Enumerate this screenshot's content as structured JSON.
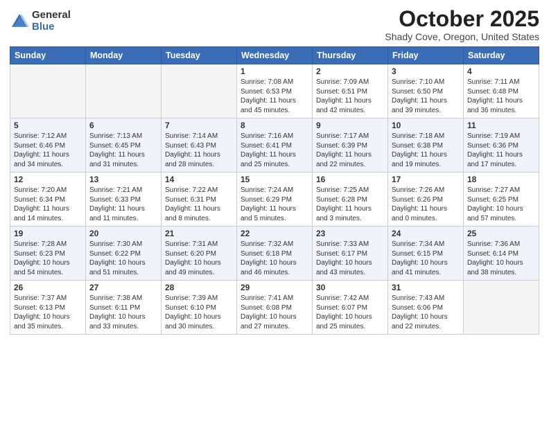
{
  "logo": {
    "general": "General",
    "blue": "Blue"
  },
  "header": {
    "month": "October 2025",
    "location": "Shady Cove, Oregon, United States"
  },
  "days_of_week": [
    "Sunday",
    "Monday",
    "Tuesday",
    "Wednesday",
    "Thursday",
    "Friday",
    "Saturday"
  ],
  "weeks": [
    [
      {
        "day": "",
        "sunrise": "",
        "sunset": "",
        "daylight": ""
      },
      {
        "day": "",
        "sunrise": "",
        "sunset": "",
        "daylight": ""
      },
      {
        "day": "",
        "sunrise": "",
        "sunset": "",
        "daylight": ""
      },
      {
        "day": "1",
        "sunrise": "Sunrise: 7:08 AM",
        "sunset": "Sunset: 6:53 PM",
        "daylight": "Daylight: 11 hours and 45 minutes."
      },
      {
        "day": "2",
        "sunrise": "Sunrise: 7:09 AM",
        "sunset": "Sunset: 6:51 PM",
        "daylight": "Daylight: 11 hours and 42 minutes."
      },
      {
        "day": "3",
        "sunrise": "Sunrise: 7:10 AM",
        "sunset": "Sunset: 6:50 PM",
        "daylight": "Daylight: 11 hours and 39 minutes."
      },
      {
        "day": "4",
        "sunrise": "Sunrise: 7:11 AM",
        "sunset": "Sunset: 6:48 PM",
        "daylight": "Daylight: 11 hours and 36 minutes."
      }
    ],
    [
      {
        "day": "5",
        "sunrise": "Sunrise: 7:12 AM",
        "sunset": "Sunset: 6:46 PM",
        "daylight": "Daylight: 11 hours and 34 minutes."
      },
      {
        "day": "6",
        "sunrise": "Sunrise: 7:13 AM",
        "sunset": "Sunset: 6:45 PM",
        "daylight": "Daylight: 11 hours and 31 minutes."
      },
      {
        "day": "7",
        "sunrise": "Sunrise: 7:14 AM",
        "sunset": "Sunset: 6:43 PM",
        "daylight": "Daylight: 11 hours and 28 minutes."
      },
      {
        "day": "8",
        "sunrise": "Sunrise: 7:16 AM",
        "sunset": "Sunset: 6:41 PM",
        "daylight": "Daylight: 11 hours and 25 minutes."
      },
      {
        "day": "9",
        "sunrise": "Sunrise: 7:17 AM",
        "sunset": "Sunset: 6:39 PM",
        "daylight": "Daylight: 11 hours and 22 minutes."
      },
      {
        "day": "10",
        "sunrise": "Sunrise: 7:18 AM",
        "sunset": "Sunset: 6:38 PM",
        "daylight": "Daylight: 11 hours and 19 minutes."
      },
      {
        "day": "11",
        "sunrise": "Sunrise: 7:19 AM",
        "sunset": "Sunset: 6:36 PM",
        "daylight": "Daylight: 11 hours and 17 minutes."
      }
    ],
    [
      {
        "day": "12",
        "sunrise": "Sunrise: 7:20 AM",
        "sunset": "Sunset: 6:34 PM",
        "daylight": "Daylight: 11 hours and 14 minutes."
      },
      {
        "day": "13",
        "sunrise": "Sunrise: 7:21 AM",
        "sunset": "Sunset: 6:33 PM",
        "daylight": "Daylight: 11 hours and 11 minutes."
      },
      {
        "day": "14",
        "sunrise": "Sunrise: 7:22 AM",
        "sunset": "Sunset: 6:31 PM",
        "daylight": "Daylight: 11 hours and 8 minutes."
      },
      {
        "day": "15",
        "sunrise": "Sunrise: 7:24 AM",
        "sunset": "Sunset: 6:29 PM",
        "daylight": "Daylight: 11 hours and 5 minutes."
      },
      {
        "day": "16",
        "sunrise": "Sunrise: 7:25 AM",
        "sunset": "Sunset: 6:28 PM",
        "daylight": "Daylight: 11 hours and 3 minutes."
      },
      {
        "day": "17",
        "sunrise": "Sunrise: 7:26 AM",
        "sunset": "Sunset: 6:26 PM",
        "daylight": "Daylight: 11 hours and 0 minutes."
      },
      {
        "day": "18",
        "sunrise": "Sunrise: 7:27 AM",
        "sunset": "Sunset: 6:25 PM",
        "daylight": "Daylight: 10 hours and 57 minutes."
      }
    ],
    [
      {
        "day": "19",
        "sunrise": "Sunrise: 7:28 AM",
        "sunset": "Sunset: 6:23 PM",
        "daylight": "Daylight: 10 hours and 54 minutes."
      },
      {
        "day": "20",
        "sunrise": "Sunrise: 7:30 AM",
        "sunset": "Sunset: 6:22 PM",
        "daylight": "Daylight: 10 hours and 51 minutes."
      },
      {
        "day": "21",
        "sunrise": "Sunrise: 7:31 AM",
        "sunset": "Sunset: 6:20 PM",
        "daylight": "Daylight: 10 hours and 49 minutes."
      },
      {
        "day": "22",
        "sunrise": "Sunrise: 7:32 AM",
        "sunset": "Sunset: 6:18 PM",
        "daylight": "Daylight: 10 hours and 46 minutes."
      },
      {
        "day": "23",
        "sunrise": "Sunrise: 7:33 AM",
        "sunset": "Sunset: 6:17 PM",
        "daylight": "Daylight: 10 hours and 43 minutes."
      },
      {
        "day": "24",
        "sunrise": "Sunrise: 7:34 AM",
        "sunset": "Sunset: 6:15 PM",
        "daylight": "Daylight: 10 hours and 41 minutes."
      },
      {
        "day": "25",
        "sunrise": "Sunrise: 7:36 AM",
        "sunset": "Sunset: 6:14 PM",
        "daylight": "Daylight: 10 hours and 38 minutes."
      }
    ],
    [
      {
        "day": "26",
        "sunrise": "Sunrise: 7:37 AM",
        "sunset": "Sunset: 6:13 PM",
        "daylight": "Daylight: 10 hours and 35 minutes."
      },
      {
        "day": "27",
        "sunrise": "Sunrise: 7:38 AM",
        "sunset": "Sunset: 6:11 PM",
        "daylight": "Daylight: 10 hours and 33 minutes."
      },
      {
        "day": "28",
        "sunrise": "Sunrise: 7:39 AM",
        "sunset": "Sunset: 6:10 PM",
        "daylight": "Daylight: 10 hours and 30 minutes."
      },
      {
        "day": "29",
        "sunrise": "Sunrise: 7:41 AM",
        "sunset": "Sunset: 6:08 PM",
        "daylight": "Daylight: 10 hours and 27 minutes."
      },
      {
        "day": "30",
        "sunrise": "Sunrise: 7:42 AM",
        "sunset": "Sunset: 6:07 PM",
        "daylight": "Daylight: 10 hours and 25 minutes."
      },
      {
        "day": "31",
        "sunrise": "Sunrise: 7:43 AM",
        "sunset": "Sunset: 6:06 PM",
        "daylight": "Daylight: 10 hours and 22 minutes."
      },
      {
        "day": "",
        "sunrise": "",
        "sunset": "",
        "daylight": ""
      }
    ]
  ]
}
